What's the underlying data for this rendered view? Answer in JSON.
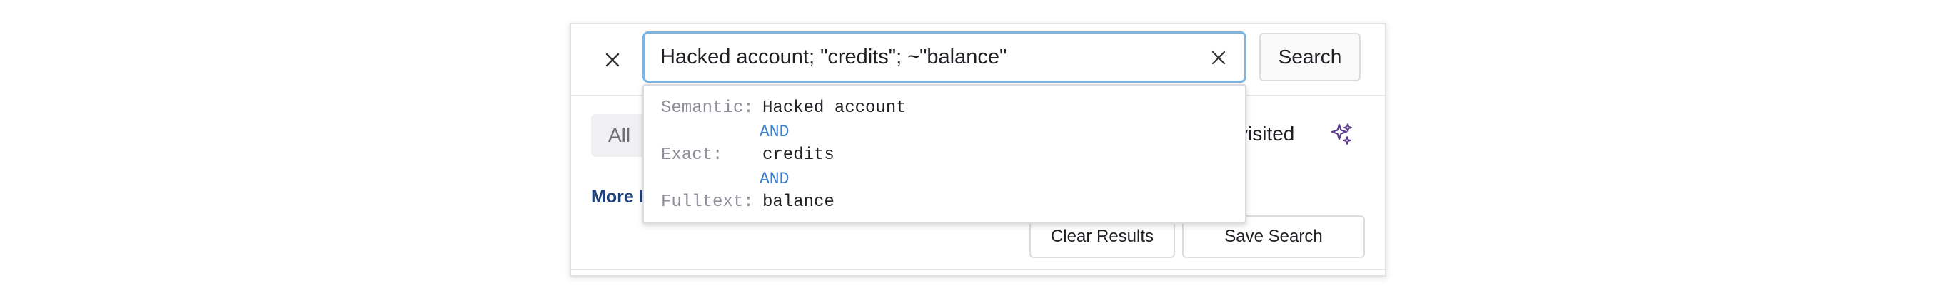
{
  "search": {
    "query": "Hacked account; \"credits\"; ~\"balance\"",
    "button_label": "Search",
    "close_icon": "close-icon",
    "clear_icon": "clear-input-icon"
  },
  "filters": {
    "all_label": "All",
    "visited_label": "visited",
    "sparkle_icon": "sparkle-icon",
    "sparkle_color": "#5a3a8c"
  },
  "more_link_label": "More F",
  "actions": {
    "clear_results_label": "Clear Results",
    "save_search_label": "Save Search"
  },
  "query_breakdown": {
    "rows": [
      {
        "key": "Semantic:",
        "value": "Hacked account"
      },
      {
        "key": "Exact:",
        "value": "credits"
      },
      {
        "key": "Fulltext:",
        "value": "balance"
      }
    ],
    "connector": "AND",
    "connector_color": "#3a7fd0"
  },
  "colors": {
    "focus_border": "#7bb5e0",
    "link": "#1d3f7a"
  }
}
